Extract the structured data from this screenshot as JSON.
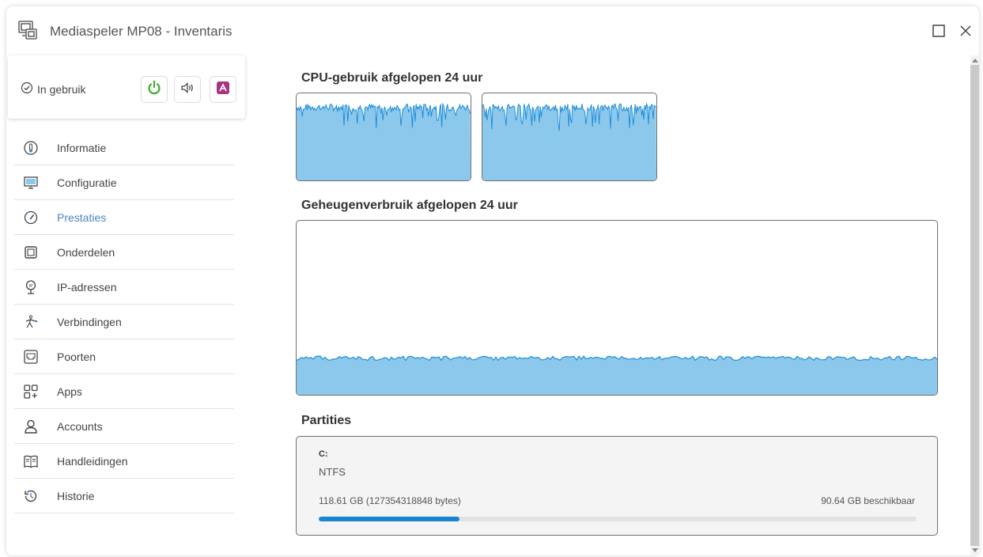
{
  "window": {
    "title": "Mediaspeler MP08 - Inventaris",
    "icon": "media-player-icon",
    "controls": [
      "maximize-icon",
      "close-icon"
    ]
  },
  "status": {
    "label": "In gebruik",
    "icon": "check-circle-icon",
    "actions": [
      {
        "name": "power",
        "icon": "power-icon",
        "color": "#3cab2f"
      },
      {
        "name": "sound",
        "icon": "speaker-icon",
        "color": "#444444"
      },
      {
        "name": "remote",
        "icon": "remote-support-icon",
        "color": "#a8357f"
      }
    ]
  },
  "sidebar": {
    "items": [
      {
        "label": "Informatie",
        "icon": "info-thermometer-icon"
      },
      {
        "label": "Configuratie",
        "icon": "configuration-icon"
      },
      {
        "label": "Prestaties",
        "icon": "gauge-icon",
        "active": true
      },
      {
        "label": "Onderdelen",
        "icon": "component-icon"
      },
      {
        "label": "IP-adressen",
        "icon": "ip-pin-icon"
      },
      {
        "label": "Verbindingen",
        "icon": "connections-icon"
      },
      {
        "label": "Poorten",
        "icon": "port-icon"
      },
      {
        "label": "Apps",
        "icon": "apps-icon"
      },
      {
        "label": "Accounts",
        "icon": "user-icon"
      },
      {
        "label": "Handleidingen",
        "icon": "manual-icon"
      },
      {
        "label": "Historie",
        "icon": "history-icon"
      }
    ],
    "active_color": "#4a86c5"
  },
  "performance": {
    "cpu_title": "CPU-gebruik afgelopen 24 uur",
    "memory_title": "Geheugenverbruik afgelopen 24 uur",
    "partitions_title": "Partities"
  },
  "chart_data": [
    {
      "type": "area",
      "title": "",
      "series_level": 0.84,
      "fill": "#8cc8eb",
      "line": "#1f8ed8"
    },
    {
      "type": "area",
      "title": "",
      "series_level": 0.84,
      "fill": "#8cc8eb",
      "line": "#1f8ed8"
    },
    {
      "type": "area",
      "title": "",
      "series_level": 0.21,
      "fill": "#8cc8eb",
      "line": "#1f8ed8"
    }
  ],
  "partition": {
    "drive": "C:",
    "filesystem": "NTFS",
    "size_text": "118.61 GB (127354318848 bytes)",
    "free_text": "90.64 GB beschikbaar",
    "used_fraction": 0.236,
    "bar_color": "#1b84cf"
  }
}
